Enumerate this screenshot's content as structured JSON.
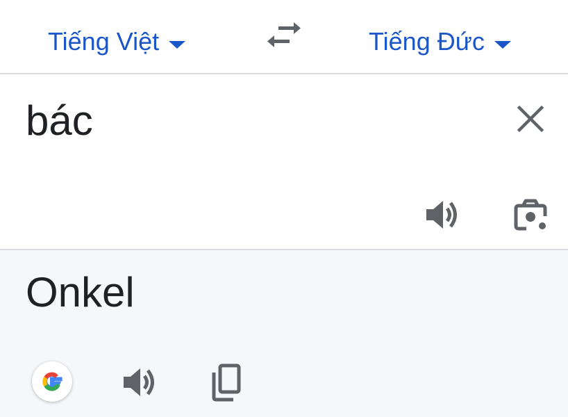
{
  "languages": {
    "source": "Tiếng Việt",
    "target": "Tiếng Đức"
  },
  "input": {
    "text": "bác"
  },
  "output": {
    "text": "Onkel"
  },
  "icons": {
    "swap": "swap-arrows-icon",
    "clear": "close-icon",
    "source_speaker": "speaker-icon",
    "camera": "camera-lens-icon",
    "google": "google-logo-icon",
    "output_speaker": "speaker-icon",
    "copy": "copy-icon"
  },
  "colors": {
    "accent": "#1a56c8",
    "output_background": "#f5f7fa",
    "icon_gray": "#5f6368"
  }
}
